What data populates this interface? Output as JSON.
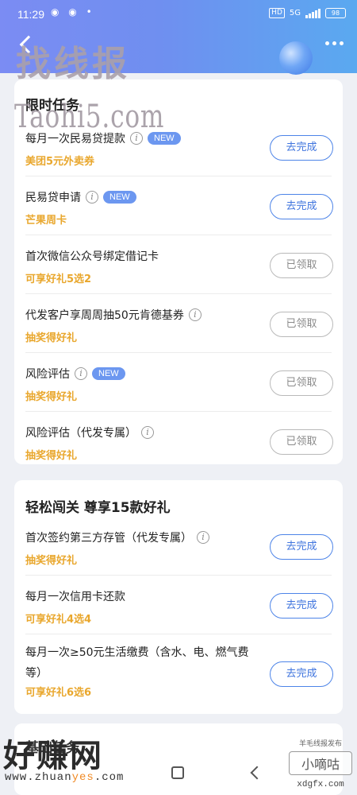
{
  "status_bar": {
    "time": "11:29",
    "dots": "◉ ◉ •",
    "hd": "HD",
    "network": "5G",
    "battery": "98"
  },
  "header": {
    "watermark": "找线报"
  },
  "section1": {
    "title": "限时任务",
    "watermark": "Taohi5.com",
    "tasks": [
      {
        "name": "每月一次民易贷提款",
        "reward": "美团5元外卖券",
        "button": "去完成",
        "info": true,
        "new": "NEW"
      },
      {
        "name": "民易贷申请",
        "reward": "芒果周卡",
        "button": "去完成",
        "info": true,
        "new": "NEW"
      },
      {
        "name": "首次微信公众号绑定借记卡",
        "reward": "可享好礼5选2",
        "button": "已领取"
      },
      {
        "name": "代发客户享周周抽50元肯德基券",
        "reward": "抽奖得好礼",
        "button": "已领取",
        "info": true
      },
      {
        "name": "风险评估",
        "reward": "抽奖得好礼",
        "button": "已领取",
        "info": true,
        "new": "NEW"
      },
      {
        "name": "风险评估（代发专属）",
        "reward": "抽奖得好礼",
        "button": "已领取",
        "info": true
      }
    ]
  },
  "section2": {
    "title": "轻松闯关 尊享15款好礼",
    "tasks": [
      {
        "name": "首次签约第三方存管（代发专属）",
        "reward": "抽奖得好礼",
        "button": "去完成",
        "info": true
      },
      {
        "name": "每月一次信用卡还款",
        "reward": "可享好礼4选4",
        "button": "去完成"
      },
      {
        "name": "每月一次≥50元生活缴费（含水、电、燃气费等）",
        "reward": "可享好礼6选6",
        "button": "去完成"
      }
    ]
  },
  "section3": {
    "title": "基础任务"
  },
  "watermarks": {
    "bottom_left_big": "好赚网",
    "bottom_left_url_a": "www.zhuan",
    "bottom_left_url_b": "yes",
    "bottom_left_url_c": ".com",
    "bottom_right_small": "羊毛线报发布",
    "bottom_right_name": "小嘀咕",
    "bottom_right_url": "xdgfx.com"
  },
  "colors": {
    "header_start": "#7b8cf3",
    "header_end": "#5aa9f0",
    "accent_blue": "#3f74de",
    "reward_orange": "#e9a72d",
    "new_badge": "#6c97f0"
  }
}
